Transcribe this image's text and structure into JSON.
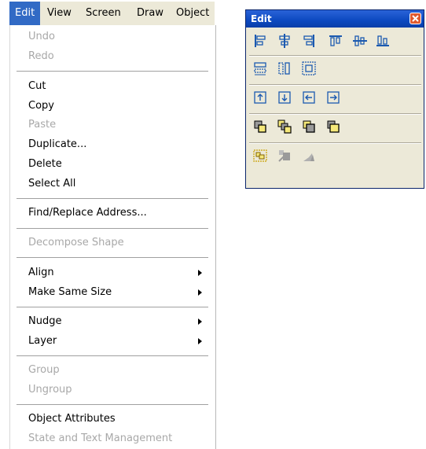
{
  "menubar": {
    "items": [
      "Edit",
      "View",
      "Screen",
      "Draw",
      "Object"
    ]
  },
  "menu": {
    "undo": "Undo",
    "redo": "Redo",
    "cut": "Cut",
    "copy": "Copy",
    "paste": "Paste",
    "duplicate": "Duplicate...",
    "delete": "Delete",
    "select_all": "Select All",
    "find_replace": "Find/Replace Address...",
    "decompose": "Decompose Shape",
    "align": "Align",
    "make_same_size": "Make Same Size",
    "nudge": "Nudge",
    "layer": "Layer",
    "group": "Group",
    "ungroup": "Ungroup",
    "object_attributes": "Object Attributes",
    "state_text": "State and Text Management"
  },
  "toolbar": {
    "title": "Edit",
    "rows": [
      [
        "align-left-icon",
        "align-center-horizontal-icon",
        "align-right-icon",
        "align-top-icon",
        "align-center-vertical-icon",
        "align-bottom-icon"
      ],
      [
        "same-width-icon",
        "same-height-icon",
        "same-size-icon"
      ],
      [
        "nudge-up-icon",
        "nudge-down-icon",
        "nudge-left-icon",
        "nudge-right-icon"
      ],
      [
        "bring-to-front-icon",
        "bring-forward-icon",
        "send-backward-icon",
        "send-to-back-icon"
      ],
      [
        "group-icon",
        "ungroup-icon",
        "decompose-shape-icon"
      ]
    ],
    "colors": {
      "icon_blue": "#1c5ab0",
      "icon_yellow": "#f5e87a",
      "icon_gray": "#9a9a9a",
      "title_blue": "#0c49c0",
      "close_red": "#e15a2e"
    }
  }
}
